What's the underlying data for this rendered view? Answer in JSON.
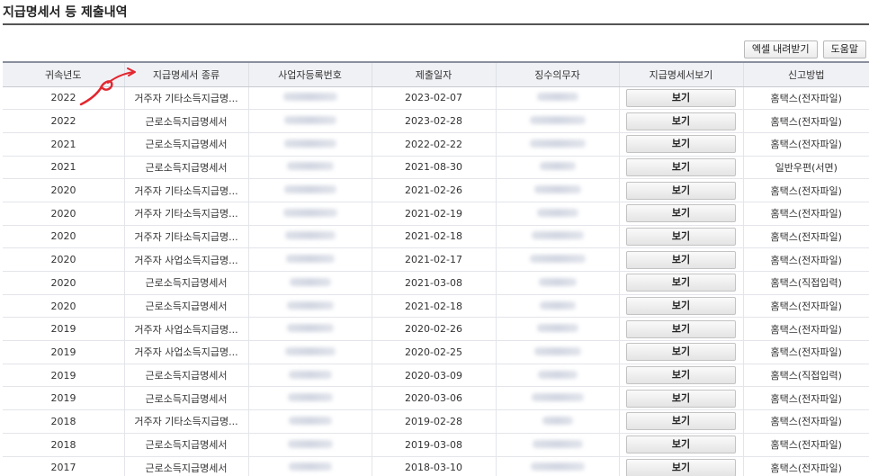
{
  "page": {
    "title": "지급명세서 등 제출내역"
  },
  "toolbar": {
    "excel_label": "엑셀 내려받기",
    "help_label": "도움말"
  },
  "table": {
    "headers": [
      "귀속년도",
      "지급명세서 종류",
      "사업자등록번호",
      "제출일자",
      "징수의무자",
      "지급명세서보기",
      "신고방법"
    ],
    "view_label": "보기",
    "rows": [
      {
        "year": "2022",
        "kind": "거주자 기타소득지급명...",
        "date": "2023-02-07",
        "method": "홈택스(전자파일)"
      },
      {
        "year": "2022",
        "kind": "근로소득지급명세서",
        "date": "2023-02-28",
        "method": "홈택스(전자파일)"
      },
      {
        "year": "2021",
        "kind": "근로소득지급명세서",
        "date": "2022-02-22",
        "method": "홈택스(전자파일)"
      },
      {
        "year": "2021",
        "kind": "근로소득지급명세서",
        "date": "2021-08-30",
        "method": "일반우편(서면)"
      },
      {
        "year": "2020",
        "kind": "거주자 기타소득지급명...",
        "date": "2021-02-26",
        "method": "홈택스(전자파일)"
      },
      {
        "year": "2020",
        "kind": "거주자 기타소득지급명...",
        "date": "2021-02-19",
        "method": "홈택스(전자파일)"
      },
      {
        "year": "2020",
        "kind": "거주자 기타소득지급명...",
        "date": "2021-02-18",
        "method": "홈택스(전자파일)"
      },
      {
        "year": "2020",
        "kind": "거주자 사업소득지급명...",
        "date": "2021-02-17",
        "method": "홈택스(전자파일)"
      },
      {
        "year": "2020",
        "kind": "근로소득지급명세서",
        "date": "2021-03-08",
        "method": "홈택스(직접입력)"
      },
      {
        "year": "2020",
        "kind": "근로소득지급명세서",
        "date": "2021-02-18",
        "method": "홈택스(전자파일)"
      },
      {
        "year": "2019",
        "kind": "거주자 사업소득지급명...",
        "date": "2020-02-26",
        "method": "홈택스(전자파일)"
      },
      {
        "year": "2019",
        "kind": "거주자 사업소득지급명...",
        "date": "2020-02-25",
        "method": "홈택스(전자파일)"
      },
      {
        "year": "2019",
        "kind": "근로소득지급명세서",
        "date": "2020-03-09",
        "method": "홈택스(직접입력)"
      },
      {
        "year": "2019",
        "kind": "근로소득지급명세서",
        "date": "2020-03-06",
        "method": "홈택스(전자파일)"
      },
      {
        "year": "2018",
        "kind": "거주자 기타소득지급명...",
        "date": "2019-02-28",
        "method": "홈택스(전자파일)"
      },
      {
        "year": "2018",
        "kind": "근로소득지급명세서",
        "date": "2019-03-08",
        "method": "홈택스(전자파일)"
      },
      {
        "year": "2017",
        "kind": "근로소득지급명세서",
        "date": "2018-03-10",
        "method": "홈택스(전자파일)"
      }
    ]
  },
  "colors": {
    "annotation": "#e3262f",
    "header_bg": "#f0f1f5"
  }
}
